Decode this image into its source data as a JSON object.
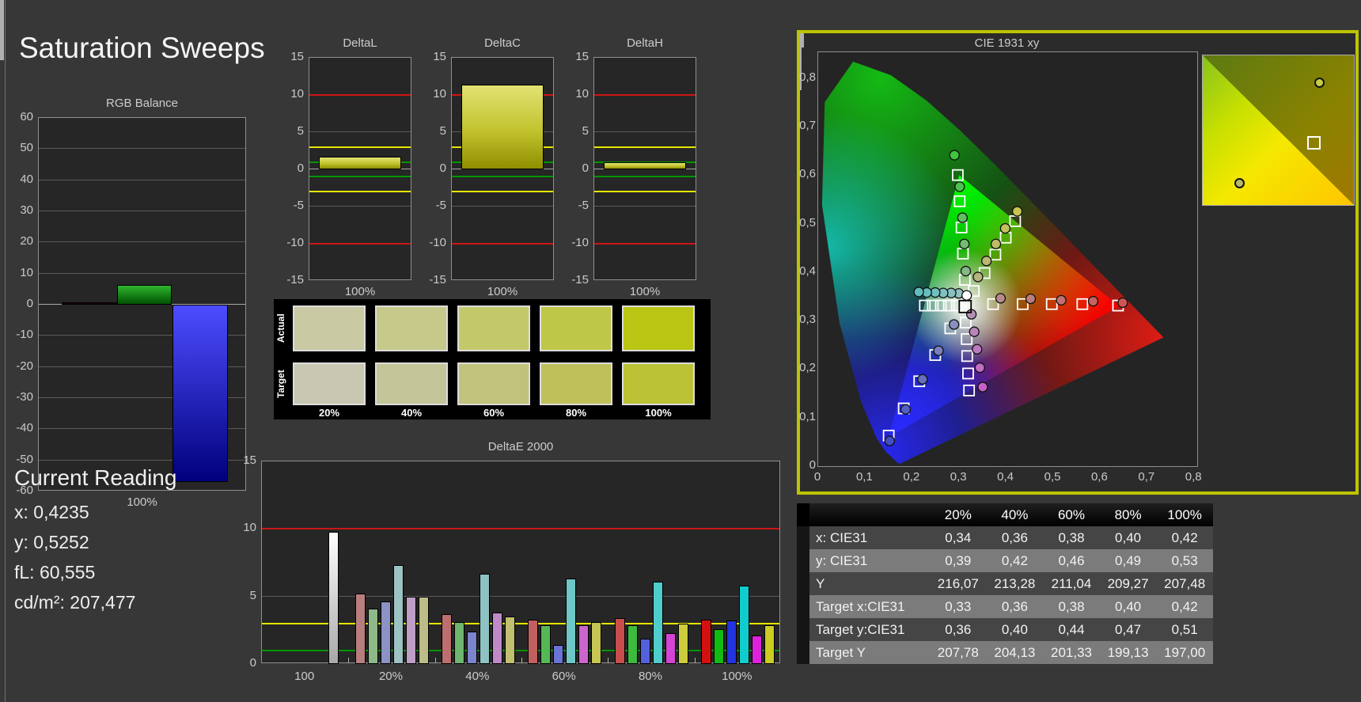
{
  "page": {
    "title": "Saturation Sweeps"
  },
  "current_reading": {
    "heading": "Current Reading",
    "lines": [
      "x: 0,4235",
      "y: 0,5252",
      "fL: 60,555",
      "cd/m²: 207,477"
    ]
  },
  "ref_colors": {
    "red": "#cc1616",
    "yellow": "#e6e600",
    "green": "#009600"
  },
  "rgb_balance": {
    "title": "RGB Balance",
    "x_label": "100%",
    "y_ticks": [
      "60",
      "50",
      "40",
      "30",
      "20",
      "10",
      "0",
      "-10",
      "-20",
      "-30",
      "-40",
      "-50",
      "-60"
    ],
    "ymin": -60,
    "ymax": 60,
    "bars": [
      {
        "name": "red",
        "value": 0.8,
        "grad_top": "#2a0000",
        "grad_bottom": "#060000"
      },
      {
        "name": "green",
        "value": 6.4,
        "grad_top": "#2fb52f",
        "grad_bottom": "#005200"
      },
      {
        "name": "blue",
        "value": -57,
        "grad_top": "#4d4dff",
        "grad_bottom": "#00007d"
      }
    ]
  },
  "delta_axis": {
    "y_ticks": [
      "15",
      "10",
      "5",
      "0",
      "-5",
      "-10",
      "-15"
    ],
    "ymin": -15,
    "ymax": 15,
    "x_label": "100%",
    "red_at": 10,
    "yellow_at": 3,
    "green_at": 1
  },
  "delta_charts": [
    {
      "title": "DeltaL",
      "value": 1.7
    },
    {
      "title": "DeltaC",
      "value": 11.4
    },
    {
      "title": "DeltaH",
      "value": 1.0
    }
  ],
  "delta_bar": {
    "grad_top": "#e2e273",
    "grad_mid": "#c2c22e",
    "grad_bottom": "#8f8f00"
  },
  "swatches": {
    "row_labels": [
      "Actual",
      "Target"
    ],
    "col_labels": [
      "20%",
      "40%",
      "60%",
      "80%",
      "100%"
    ],
    "actual": [
      "#c9caa4",
      "#c6c989",
      "#c3c96b",
      "#bfc748",
      "#bac514"
    ],
    "target": [
      "#c8c8b2",
      "#c4c598",
      "#c1c27c",
      "#bec05a",
      "#bcc235"
    ]
  },
  "deltae": {
    "title": "DeltaE 2000",
    "y_ticks": [
      "15",
      "10",
      "5",
      "0"
    ],
    "ymax": 15,
    "groups": [
      {
        "label": "100",
        "values": [
          9.8
        ],
        "colors": [
          "#ffffff"
        ]
      },
      {
        "label": "20%",
        "values": [
          5.2,
          4.1,
          4.6,
          7.3,
          5.0,
          5.0
        ],
        "colors": [
          "#b87e7e",
          "#8db888",
          "#8b92c4",
          "#9dc2c2",
          "#bd9fc6",
          "#bcbc88"
        ]
      },
      {
        "label": "40%",
        "values": [
          3.7,
          3.1,
          2.4,
          6.7,
          3.8,
          3.5
        ],
        "colors": [
          "#bd6f6f",
          "#6fb56f",
          "#7c84cc",
          "#8fc2c2",
          "#c08ac9",
          "#c0c070"
        ]
      },
      {
        "label": "60%",
        "values": [
          3.3,
          2.9,
          1.4,
          6.3,
          2.9,
          3.1
        ],
        "colors": [
          "#c26060",
          "#55b855",
          "#6b74d4",
          "#6fc6c6",
          "#cc66cc",
          "#c6c655"
        ]
      },
      {
        "label": "80%",
        "values": [
          3.4,
          2.9,
          1.85,
          6.1,
          2.3,
          3.0
        ],
        "colors": [
          "#c94d4d",
          "#3dbb3d",
          "#5560dd",
          "#4fcccc",
          "#d544d5",
          "#cccc3d"
        ]
      },
      {
        "label": "100%",
        "values": [
          3.3,
          2.6,
          3.2,
          5.8,
          2.1,
          2.9
        ],
        "colors": [
          "#d41111",
          "#11bb11",
          "#2233e0",
          "#11cccc",
          "#dd22dd",
          "#cccc22"
        ]
      }
    ]
  },
  "cie": {
    "title": "CIE 1931 xy",
    "x_ticks": [
      "0",
      "0,1",
      "0,2",
      "0,3",
      "0,4",
      "0,5",
      "0,6",
      "0,7",
      "0,8"
    ],
    "y_ticks": [
      "0",
      "0,1",
      "0,2",
      "0,3",
      "0,4",
      "0,5",
      "0,6",
      "0,7",
      "0,8"
    ],
    "locus": [
      [
        0.1741,
        0.005
      ],
      [
        0.1714,
        0.0051
      ],
      [
        0.1644,
        0.0109
      ],
      [
        0.144,
        0.0297
      ],
      [
        0.1241,
        0.0578
      ],
      [
        0.0913,
        0.1327
      ],
      [
        0.0454,
        0.295
      ],
      [
        0.0082,
        0.5384
      ],
      [
        0.0139,
        0.7502
      ],
      [
        0.0743,
        0.8338
      ],
      [
        0.1547,
        0.8059
      ],
      [
        0.2296,
        0.7543
      ],
      [
        0.3016,
        0.6923
      ],
      [
        0.3731,
        0.6245
      ],
      [
        0.4441,
        0.5547
      ],
      [
        0.5125,
        0.4866
      ],
      [
        0.5752,
        0.4242
      ],
      [
        0.627,
        0.3725
      ],
      [
        0.6658,
        0.334
      ],
      [
        0.6915,
        0.3083
      ],
      [
        0.719,
        0.2809
      ],
      [
        0.7347,
        0.2653
      ]
    ],
    "triangle": [
      [
        0.64,
        0.33
      ],
      [
        0.3,
        0.6
      ],
      [
        0.15,
        0.06
      ]
    ],
    "white_point": {
      "target": [
        0.3127,
        0.329
      ],
      "measured": [
        0.316,
        0.352
      ]
    },
    "sweeps": [
      {
        "name": "red",
        "circle_fill": [
          "#b98a8a",
          "#bd7d7d",
          "#c27070",
          "#c66262",
          "#cc5555"
        ],
        "targets": [
          [
            0.372,
            0.334
          ],
          [
            0.435,
            0.334
          ],
          [
            0.497,
            0.334
          ],
          [
            0.562,
            0.334
          ],
          [
            0.638,
            0.331
          ]
        ],
        "measured": [
          [
            0.388,
            0.346
          ],
          [
            0.452,
            0.345
          ],
          [
            0.517,
            0.342
          ],
          [
            0.585,
            0.34
          ],
          [
            0.648,
            0.337
          ]
        ]
      },
      {
        "name": "green",
        "circle_fill": [
          "#86b886",
          "#74bb74",
          "#62be62",
          "#50c150",
          "#3ec43e"
        ],
        "targets": [
          [
            0.312,
            0.384
          ],
          [
            0.308,
            0.438
          ],
          [
            0.305,
            0.492
          ],
          [
            0.301,
            0.546
          ],
          [
            0.297,
            0.6
          ]
        ],
        "measured": [
          [
            0.314,
            0.402
          ],
          [
            0.311,
            0.458
          ],
          [
            0.307,
            0.512
          ],
          [
            0.301,
            0.576
          ],
          [
            0.29,
            0.641
          ]
        ]
      },
      {
        "name": "blue",
        "circle_fill": [
          "#8a8fc0",
          "#787fc0",
          "#666fc0",
          "#545fc0",
          "#424fc0"
        ],
        "targets": [
          [
            0.281,
            0.284
          ],
          [
            0.249,
            0.229
          ],
          [
            0.215,
            0.175
          ],
          [
            0.182,
            0.119
          ],
          [
            0.15,
            0.063
          ]
        ],
        "measured": [
          [
            0.289,
            0.292
          ],
          [
            0.256,
            0.238
          ],
          [
            0.222,
            0.179
          ],
          [
            0.186,
            0.117
          ],
          [
            0.152,
            0.052
          ]
        ]
      },
      {
        "name": "cyan",
        "circle_fill": [
          "#93c2c2",
          "#88c1c1",
          "#7dc0c0",
          "#72bfbf",
          "#67bebe",
          "#5fbdbd"
        ],
        "targets": [
          [
            0.295,
            0.331
          ],
          [
            0.278,
            0.331
          ],
          [
            0.261,
            0.331
          ],
          [
            0.244,
            0.331
          ],
          [
            0.227,
            0.331
          ]
        ],
        "measured": [
          [
            0.299,
            0.356
          ],
          [
            0.283,
            0.357
          ],
          [
            0.266,
            0.357
          ],
          [
            0.249,
            0.358
          ],
          [
            0.231,
            0.358
          ],
          [
            0.214,
            0.359
          ]
        ]
      },
      {
        "name": "magenta",
        "circle_fill": [
          "#b490b4",
          "#b984b9",
          "#be78be",
          "#c36cc3",
          "#c860c8"
        ],
        "targets": [
          [
            0.314,
            0.296
          ],
          [
            0.316,
            0.262
          ],
          [
            0.317,
            0.227
          ],
          [
            0.319,
            0.191
          ],
          [
            0.321,
            0.156
          ]
        ],
        "measured": [
          [
            0.326,
            0.313
          ],
          [
            0.332,
            0.277
          ],
          [
            0.338,
            0.241
          ],
          [
            0.344,
            0.203
          ],
          [
            0.35,
            0.163
          ]
        ]
      },
      {
        "name": "yellow",
        "circle_fill": [
          "#b5b57f",
          "#bab873",
          "#bfbc67",
          "#c4c05b",
          "#c9c44f"
        ],
        "targets": [
          [
            0.331,
            0.361
          ],
          [
            0.354,
            0.398
          ],
          [
            0.377,
            0.436
          ],
          [
            0.399,
            0.471
          ],
          [
            0.419,
            0.505
          ]
        ],
        "measured": [
          [
            0.34,
            0.39
          ],
          [
            0.358,
            0.423
          ],
          [
            0.378,
            0.458
          ],
          [
            0.398,
            0.49
          ],
          [
            0.4235,
            0.5252
          ]
        ]
      }
    ],
    "inset": {
      "circle_top": {
        "x_pct": 74,
        "y_pct": 15,
        "fill": "#c9cc42"
      },
      "square": {
        "x_pct": 69,
        "y_pct": 54
      },
      "circle_bot": {
        "x_pct": 21,
        "y_pct": 82,
        "fill": "#b9b96a"
      }
    }
  },
  "table": {
    "columns": [
      "20%",
      "40%",
      "60%",
      "80%",
      "100%"
    ],
    "rows": [
      {
        "label": "x: CIE31",
        "values": [
          "0,34",
          "0,36",
          "0,38",
          "0,40",
          "0,42"
        ]
      },
      {
        "label": "y: CIE31",
        "values": [
          "0,39",
          "0,42",
          "0,46",
          "0,49",
          "0,53"
        ]
      },
      {
        "label": "Y",
        "values": [
          "216,07",
          "213,28",
          "211,04",
          "209,27",
          "207,48"
        ]
      },
      {
        "label": "Target x:CIE31",
        "values": [
          "0,33",
          "0,36",
          "0,38",
          "0,40",
          "0,42"
        ]
      },
      {
        "label": "Target y:CIE31",
        "values": [
          "0,36",
          "0,40",
          "0,44",
          "0,47",
          "0,51"
        ]
      },
      {
        "label": "Target Y",
        "values": [
          "207,78",
          "204,13",
          "201,33",
          "199,13",
          "197,00"
        ]
      }
    ],
    "row_bg_dark": "#454545",
    "row_bg_light": "#7b7b7b",
    "header_bg": "#0d0d0d"
  }
}
